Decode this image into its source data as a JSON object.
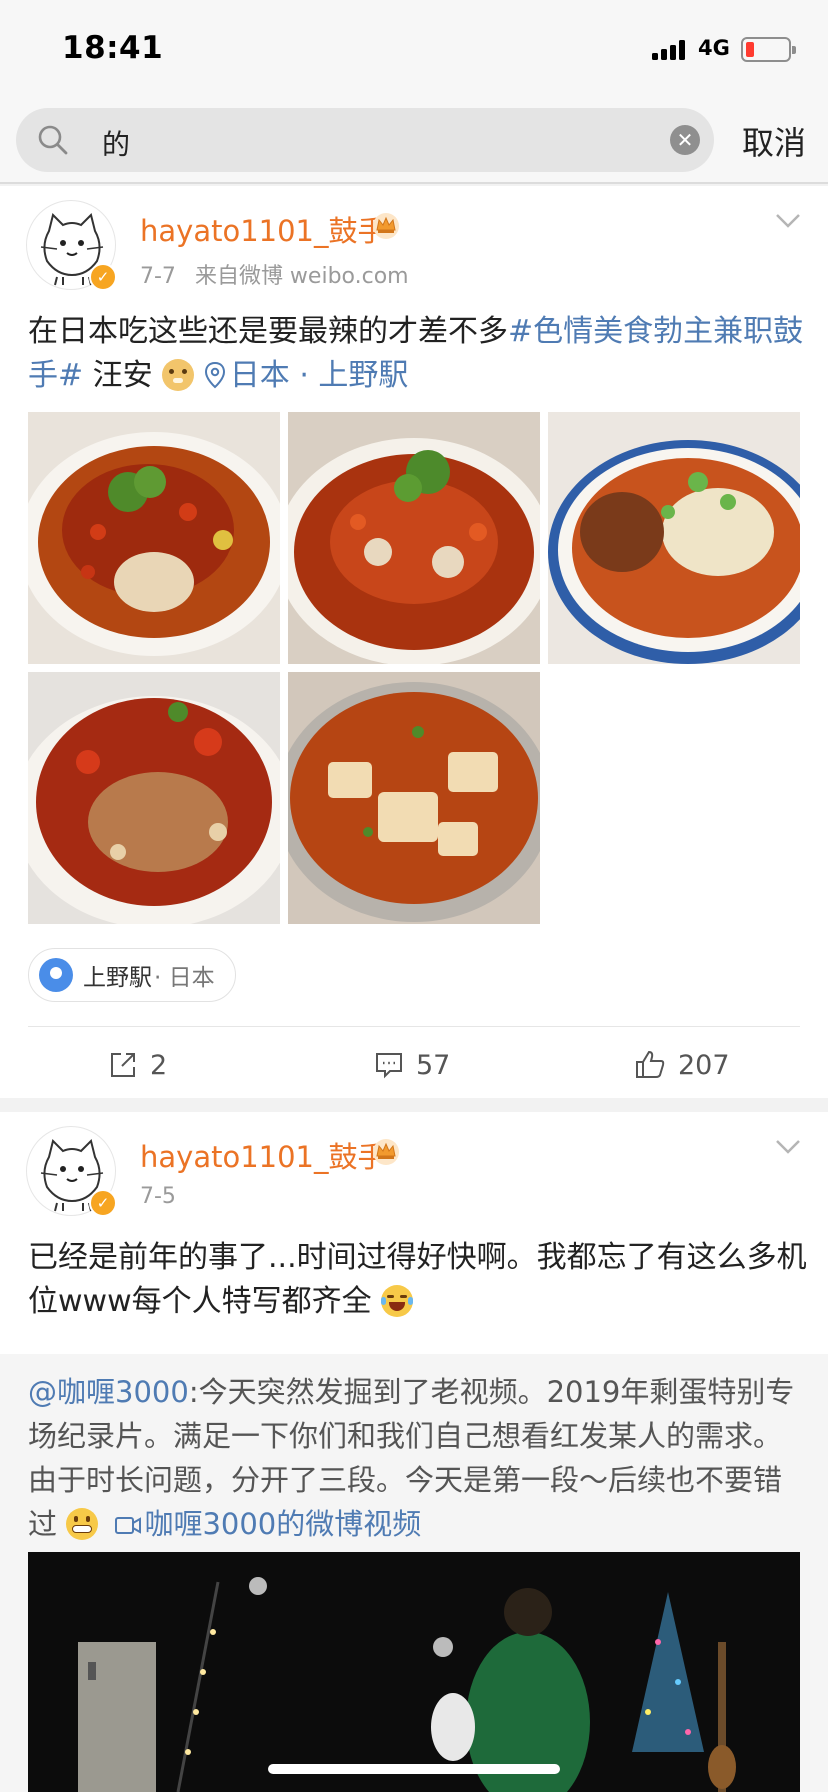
{
  "status_bar": {
    "time": "18:41",
    "network": "4G",
    "battery_color": "#ff3b30"
  },
  "search": {
    "query": "的",
    "cancel_label": "取消"
  },
  "posts": [
    {
      "username": "hayato1101_鼓手",
      "date": "7-7",
      "source": "来自微博 weibo.com",
      "text_plain": "在日本吃这些还是要最辣的才差不多",
      "topic": "#色情美食勃主兼职鼓手#",
      "text_after": " 汪安",
      "location_inline": "日本 · 上野駅",
      "location_chip": {
        "name": "上野駅",
        "country": "· 日本"
      },
      "actions": {
        "reposts": "2",
        "comments": "57",
        "likes": "207"
      }
    },
    {
      "username": "hayato1101_鼓手",
      "date": "7-5",
      "text": "已经是前年的事了...时间过得好快啊。我都忘了有这么多机位www每个人特写都齐全",
      "repost": {
        "user": "@咖喱3000",
        "text": ":今天突然发掘到了老视频。2019年剩蛋特别专场纪录片。满足一下你们和我们自己想看红发某人的需求。由于时长问题，分开了三段。今天是第一段～后续也不要错过",
        "video_link": "咖喱3000的微博视频"
      }
    }
  ],
  "colors": {
    "username": "#eb7325",
    "link": "#4f7bb3",
    "verified": "#f7a521"
  }
}
